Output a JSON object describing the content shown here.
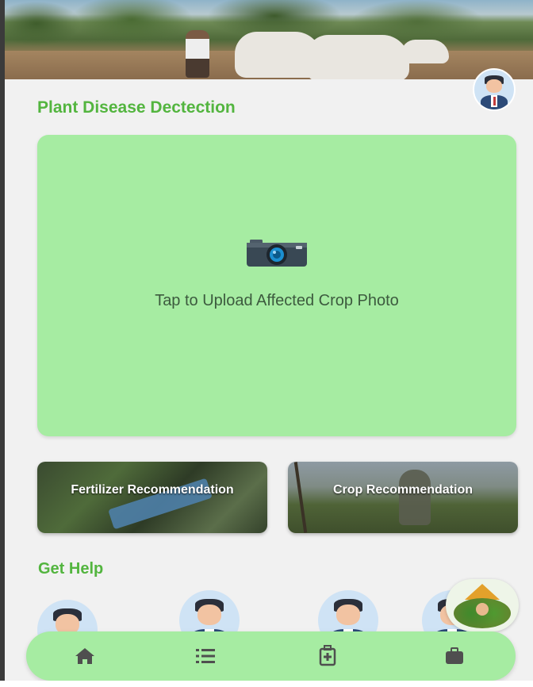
{
  "section": {
    "title": "Plant Disease Dectection"
  },
  "upload": {
    "label": "Tap to Upload Affected Crop Photo",
    "icon": "camera-icon"
  },
  "recommendations": [
    {
      "label": "Fertilizer Recommendation"
    },
    {
      "label": "Crop Recommendation"
    }
  ],
  "help": {
    "title": "Get Help",
    "experts": [
      "avatar",
      "avatar",
      "avatar",
      "avatar"
    ]
  },
  "nav": [
    {
      "icon": "home-icon"
    },
    {
      "icon": "list-icon"
    },
    {
      "icon": "medical-kit-icon"
    },
    {
      "icon": "briefcase-icon"
    }
  ],
  "colors": {
    "accent": "#53b53f",
    "card": "#a6eca2",
    "background": "#f1f1f1"
  }
}
